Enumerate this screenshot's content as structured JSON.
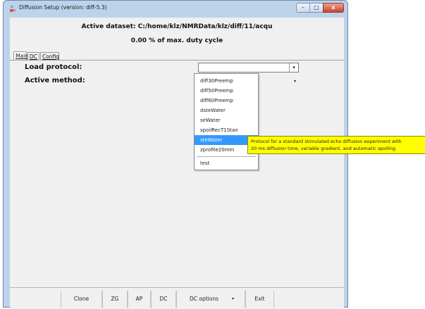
{
  "window": {
    "title": "Diffusion Setup (version: diff-5.3)",
    "controls": {
      "minimize": "–",
      "maximize": "□",
      "close": "x"
    }
  },
  "header": {
    "active_dataset": "Active dataset: C:/home/klz/NMRData/klz/diff/11/acqu",
    "duty_cycle": "0.00 % of max. duty cycle"
  },
  "tabs": [
    {
      "label": "Main",
      "selected": true
    },
    {
      "label": "DC",
      "selected": false
    },
    {
      "label": "Config",
      "selected": false
    }
  ],
  "main": {
    "load_protocol_label": "Load protocol:",
    "active_method_label": "Active method:",
    "load_protocol_value": "",
    "combo_arrow": "▾",
    "active_method_arrow": "▾"
  },
  "dropdown": {
    "items": [
      "diff30Preemp",
      "diff50Preemp",
      "diff60Preemp",
      "dsteWater",
      "seWater",
      "spoilRecT1Stan",
      "steWater",
      "zprofile20mm",
      "test"
    ],
    "selected": "steWater"
  },
  "tooltip": {
    "line1": "Protocol for a standard stimulated echo diffusion experiment with",
    "line2": "20 ms diffusion time, variable gradient, and automatic spoiling"
  },
  "buttons": {
    "clone": "Clone",
    "zg": "ZG",
    "ap": "AP",
    "dc": "DC",
    "dc_options": "DC options",
    "dc_options_arrow": "▾",
    "exit": "Exit"
  },
  "colors": {
    "window_frame": "#bcd3ea",
    "client_bg": "#f0f0f0",
    "selection": "#3399ff",
    "tooltip_bg": "#ffff00",
    "close_button": "#c9452e"
  },
  "icons": {
    "app": "java-cup-icon"
  }
}
